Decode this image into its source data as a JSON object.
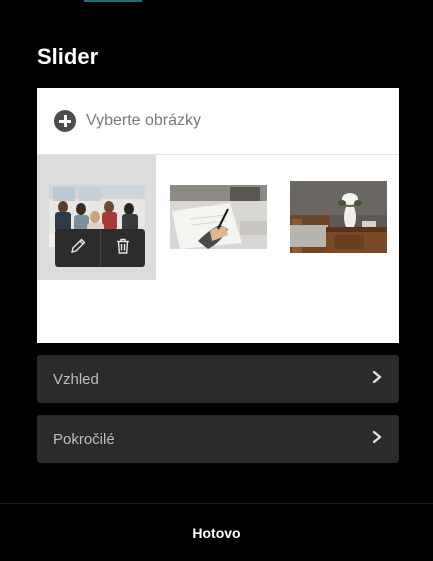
{
  "dialog": {
    "title": "Slider"
  },
  "gallery": {
    "select_label": "Vyberte obrázky",
    "images": [
      {
        "subject": "people-meeting-photo",
        "selected": true
      },
      {
        "subject": "hand-writing-photo",
        "selected": false
      },
      {
        "subject": "vase-bedroom-photo",
        "selected": false
      }
    ]
  },
  "sections": [
    {
      "label": "Vzhled"
    },
    {
      "label": "Pokročilé"
    }
  ],
  "footer": {
    "done_label": "Hotovo"
  },
  "colors": {
    "accent": "#1b6f7a",
    "panel": "#2b2b2b",
    "background": "#000000"
  }
}
